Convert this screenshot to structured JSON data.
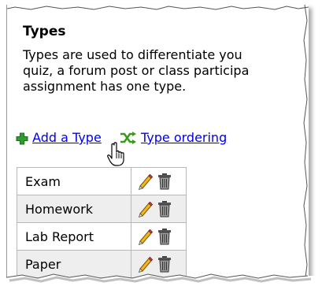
{
  "section": {
    "title": "Types",
    "description_lines": [
      "Types are used to differentiate you",
      "quiz, a forum post or class participa",
      "assignment has one type."
    ]
  },
  "actions": {
    "add_type": "Add a Type",
    "type_ordering": "Type ordering"
  },
  "types": [
    {
      "name": "Exam"
    },
    {
      "name": "Homework"
    },
    {
      "name": "Lab Report"
    },
    {
      "name": "Paper"
    }
  ],
  "icons": {
    "add": "plus-icon",
    "ordering": "shuffle-icon",
    "edit": "pencil-icon",
    "delete": "trash-icon",
    "cursor": "hand-pointer-icon"
  },
  "colors": {
    "link": "#0000ee",
    "add_icon": "#2e9e2e",
    "row_alt": "#eeeeee"
  }
}
